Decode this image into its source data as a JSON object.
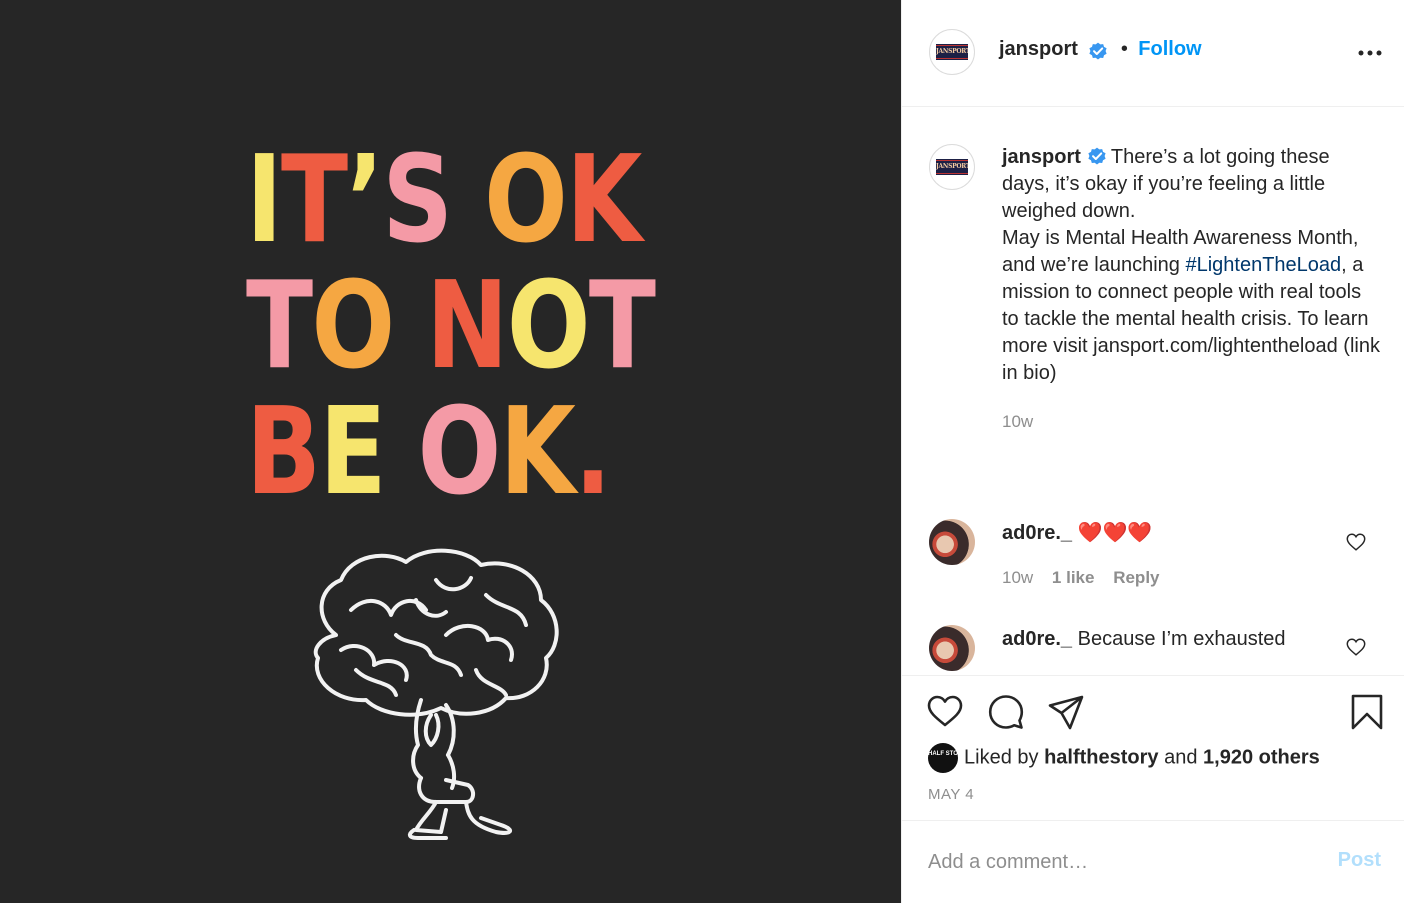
{
  "post": {
    "image": {
      "lines": [
        [
          {
            "t": "I",
            "c": "#f6e56e"
          },
          {
            "t": "T",
            "c": "#ee5c42"
          },
          {
            "t": "’",
            "c": "#f6e56e"
          },
          {
            "t": "S",
            "c": "#f49aa6"
          },
          {
            "t": " ",
            "c": "#f6e56e"
          },
          {
            "t": "O",
            "c": "#f5a742"
          },
          {
            "t": "K",
            "c": "#ee5c42"
          }
        ],
        [
          {
            "t": "T",
            "c": "#f49aa6"
          },
          {
            "t": "O",
            "c": "#f5a742"
          },
          {
            "t": " ",
            "c": "#f6e56e"
          },
          {
            "t": "N",
            "c": "#ee5c42"
          },
          {
            "t": "O",
            "c": "#f6e56e"
          },
          {
            "t": "T",
            "c": "#f49aa6"
          }
        ],
        [
          {
            "t": "B",
            "c": "#ee5c42"
          },
          {
            "t": "E",
            "c": "#f6e56e"
          },
          {
            "t": " ",
            "c": "#f6e56e"
          },
          {
            "t": "O",
            "c": "#f49aa6"
          },
          {
            "t": "K",
            "c": "#f5a742"
          },
          {
            "t": ".",
            "c": "#ee5c42"
          }
        ]
      ]
    }
  },
  "header": {
    "username": "jansport",
    "separator": "•",
    "follow_label": "Follow",
    "avatar_text": "JANSPORT"
  },
  "caption": {
    "username": "jansport",
    "text_1": "There’s a lot going these days, it’s okay if you’re feeling a little weighed down.",
    "text_2": "May is Mental Health Awareness Month, and we’re launching ",
    "hashtag": "#LightenTheLoad",
    "text_3": ", a mission to connect people with real tools to tackle the mental health crisis. To learn more visit jansport.com/lightentheload (link in bio)",
    "time": "10w"
  },
  "comments": [
    {
      "username": "ad0re._",
      "text": "❤️❤️❤️",
      "time": "10w",
      "likes": "1 like",
      "reply": "Reply"
    },
    {
      "username": "ad0re._",
      "text": "Because I’m exhausted"
    }
  ],
  "likes": {
    "prefix": "Liked by ",
    "liker": "halfthestory",
    "middle": " and ",
    "count": "1,920 others",
    "liker_avatar_text": "HALF STORY"
  },
  "date": "MAY 4",
  "comment_box": {
    "placeholder": "Add a comment…",
    "post_label": "Post"
  },
  "colors": {
    "accent": "#0095f6",
    "verified": "#3897f0",
    "hashtag": "#00376b"
  },
  "icons": [
    "more-icon",
    "verified-badge-icon",
    "heart-icon",
    "comment-icon",
    "share-icon",
    "bookmark-icon",
    "brain-illustration"
  ]
}
